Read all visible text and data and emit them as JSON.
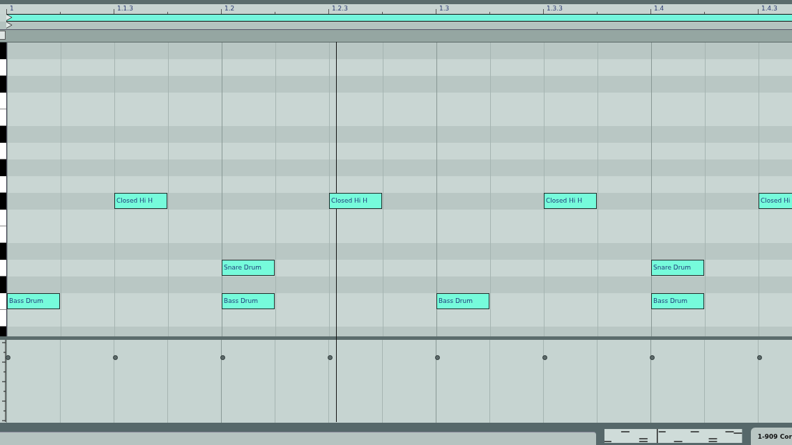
{
  "ruler": {
    "labels": [
      "1",
      "1.1.3",
      "1.2",
      "1.2.3",
      "1.3",
      "1.3.3",
      "1.4",
      "1.4.3"
    ]
  },
  "lanes": [
    {
      "black": true
    },
    {
      "black": false
    },
    {
      "black": true
    },
    {
      "black": false
    },
    {
      "black": false
    },
    {
      "black": true
    },
    {
      "black": false
    },
    {
      "black": true
    },
    {
      "black": false
    },
    {
      "black": true,
      "cells": [
        {
          "on": false
        },
        {
          "on": false
        },
        {
          "on": true,
          "name": "Closed Hi H"
        },
        {
          "on": false
        },
        {
          "on": false
        },
        {
          "on": false
        },
        {
          "on": true,
          "name": "Closed Hi H"
        },
        {
          "on": false
        },
        {
          "on": false
        },
        {
          "on": false
        },
        {
          "on": true,
          "name": "Closed Hi H"
        },
        {
          "on": false
        },
        {
          "on": false
        },
        {
          "on": false
        },
        {
          "on": true,
          "name": "Closed Hi"
        }
      ]
    },
    {
      "black": false
    },
    {
      "black": false
    },
    {
      "black": true
    },
    {
      "black": false,
      "cells": [
        {
          "on": false
        },
        {
          "on": false
        },
        {
          "on": false
        },
        {
          "on": false
        },
        {
          "on": true,
          "name": "Snare Drum"
        },
        {
          "on": false
        },
        {
          "on": false
        },
        {
          "on": false
        },
        {
          "on": false
        },
        {
          "on": false
        },
        {
          "on": false
        },
        {
          "on": false
        },
        {
          "on": true,
          "name": "Snare Drum"
        }
      ]
    },
    {
      "black": true
    },
    {
      "black": false,
      "cells": [
        {
          "on": true,
          "name": "Bass Drum"
        },
        {
          "on": false
        },
        {
          "on": false
        },
        {
          "on": false
        },
        {
          "on": true,
          "name": "Bass Drum"
        },
        {
          "on": false
        },
        {
          "on": false
        },
        {
          "on": false
        },
        {
          "on": true,
          "name": "Bass Drum"
        },
        {
          "on": false
        },
        {
          "on": false
        },
        {
          "on": false
        },
        {
          "on": true,
          "name": "Bass Drum"
        }
      ]
    },
    {
      "black": false
    },
    {
      "black": true
    }
  ],
  "status": {
    "device": "1-909 Cor"
  }
}
